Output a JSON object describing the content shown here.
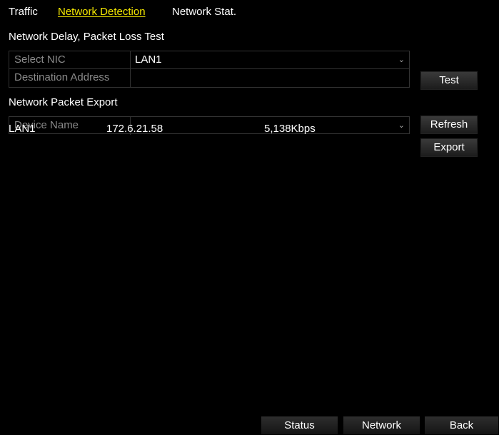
{
  "tabs": [
    {
      "label": "Traffic",
      "active": false
    },
    {
      "label": "Network Detection",
      "active": true
    },
    {
      "label": "Network Stat.",
      "active": false
    }
  ],
  "delay_test": {
    "title": "Network Delay, Packet Loss Test",
    "select_nic_label": "Select NIC",
    "select_nic_value": "LAN1",
    "dest_label": "Destination Address",
    "dest_value": "",
    "test_button": "Test"
  },
  "packet_export": {
    "title": "Network Packet Export",
    "device_name_label": "Device Name",
    "device_name_value": "",
    "refresh_button": "Refresh",
    "export_button": "Export",
    "rows": [
      {
        "nic": "LAN1",
        "ip": "172.6.21.58",
        "rate": "5,138Kbps"
      }
    ]
  },
  "footer": {
    "status_button": "Status",
    "network_button": "Network",
    "back_button": "Back"
  },
  "colors": {
    "background": "#000000",
    "active_tab": "#f3e600",
    "label_gray": "#8a8a8a"
  },
  "icons": {
    "dropdown": "chevron-down-icon"
  }
}
